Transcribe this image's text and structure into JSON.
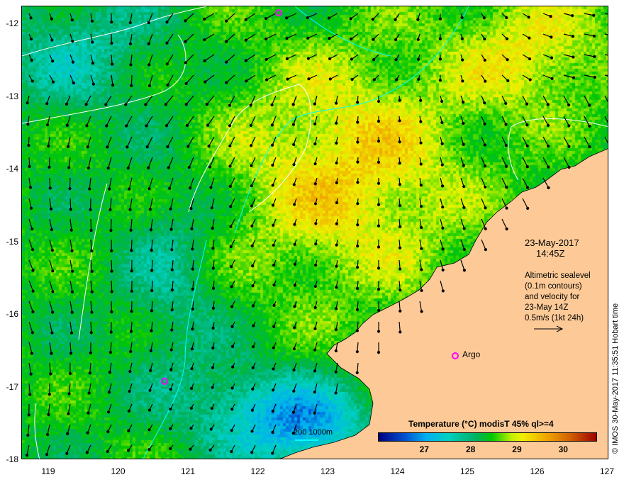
{
  "map": {
    "lon_ticks": [
      "119",
      "120",
      "121",
      "122",
      "123",
      "124",
      "125",
      "126",
      "127"
    ],
    "lat_ticks": [
      "-12",
      "-13",
      "-14",
      "-15",
      "-16",
      "-17",
      "-18"
    ],
    "date": "23-May-2017",
    "time": "14:45Z",
    "altimetry_note": [
      "Altimetric sealevel",
      "(0.1m contours)",
      "and velocity for",
      "23-May 14Z",
      "0.5m/s (1kt 24h)"
    ],
    "isobath_label": "200  1000m",
    "argo_label": "Argo",
    "credit": "© IMOS 30-May-2017 11:35:51 Hobart time"
  },
  "colorbar": {
    "title": "Temperature (°C) modisT 45% ql>=4",
    "ticks": [
      "27",
      "28",
      "29",
      "30"
    ],
    "range": [
      26.0,
      30.7
    ]
  },
  "colors": {
    "land": "#fdca97",
    "argo": "#ff00ff",
    "contour": "#ffffff",
    "isobath": "#00ffff"
  }
}
